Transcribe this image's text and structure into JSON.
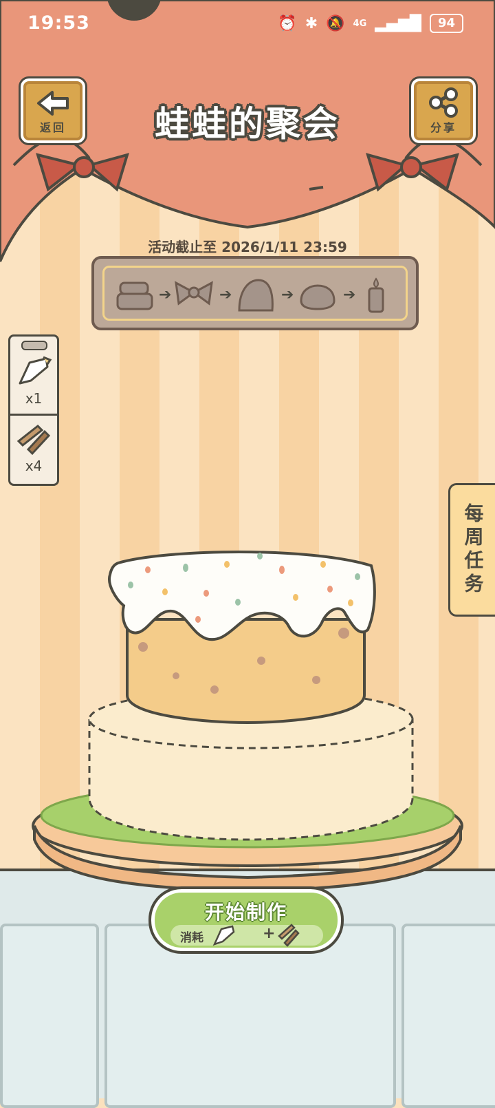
{
  "status_bar": {
    "time": "19:53",
    "network": "4G",
    "battery": "94"
  },
  "header": {
    "back_label": "返回",
    "title": "蛙蛙的聚会",
    "share_label": "分享"
  },
  "event": {
    "deadline": "活动截止至 2026/1/11 23:59",
    "steps": [
      "cake-base-icon",
      "bow-icon",
      "shell-icon",
      "frog-icon",
      "candle-icon"
    ]
  },
  "inventory": {
    "items": [
      {
        "icon": "piping-bag-icon",
        "count": "x1"
      },
      {
        "icon": "tools-icon",
        "count": "x4"
      }
    ]
  },
  "weekly_tasks": {
    "label": "每周任务"
  },
  "start_button": {
    "label": "开始制作",
    "cost_label": "消耗",
    "plus": "+"
  },
  "colors": {
    "curtain": "#e9967a",
    "outline": "#4c4a40",
    "button_green": "#a9d16a",
    "wood": "#d9a64e"
  }
}
